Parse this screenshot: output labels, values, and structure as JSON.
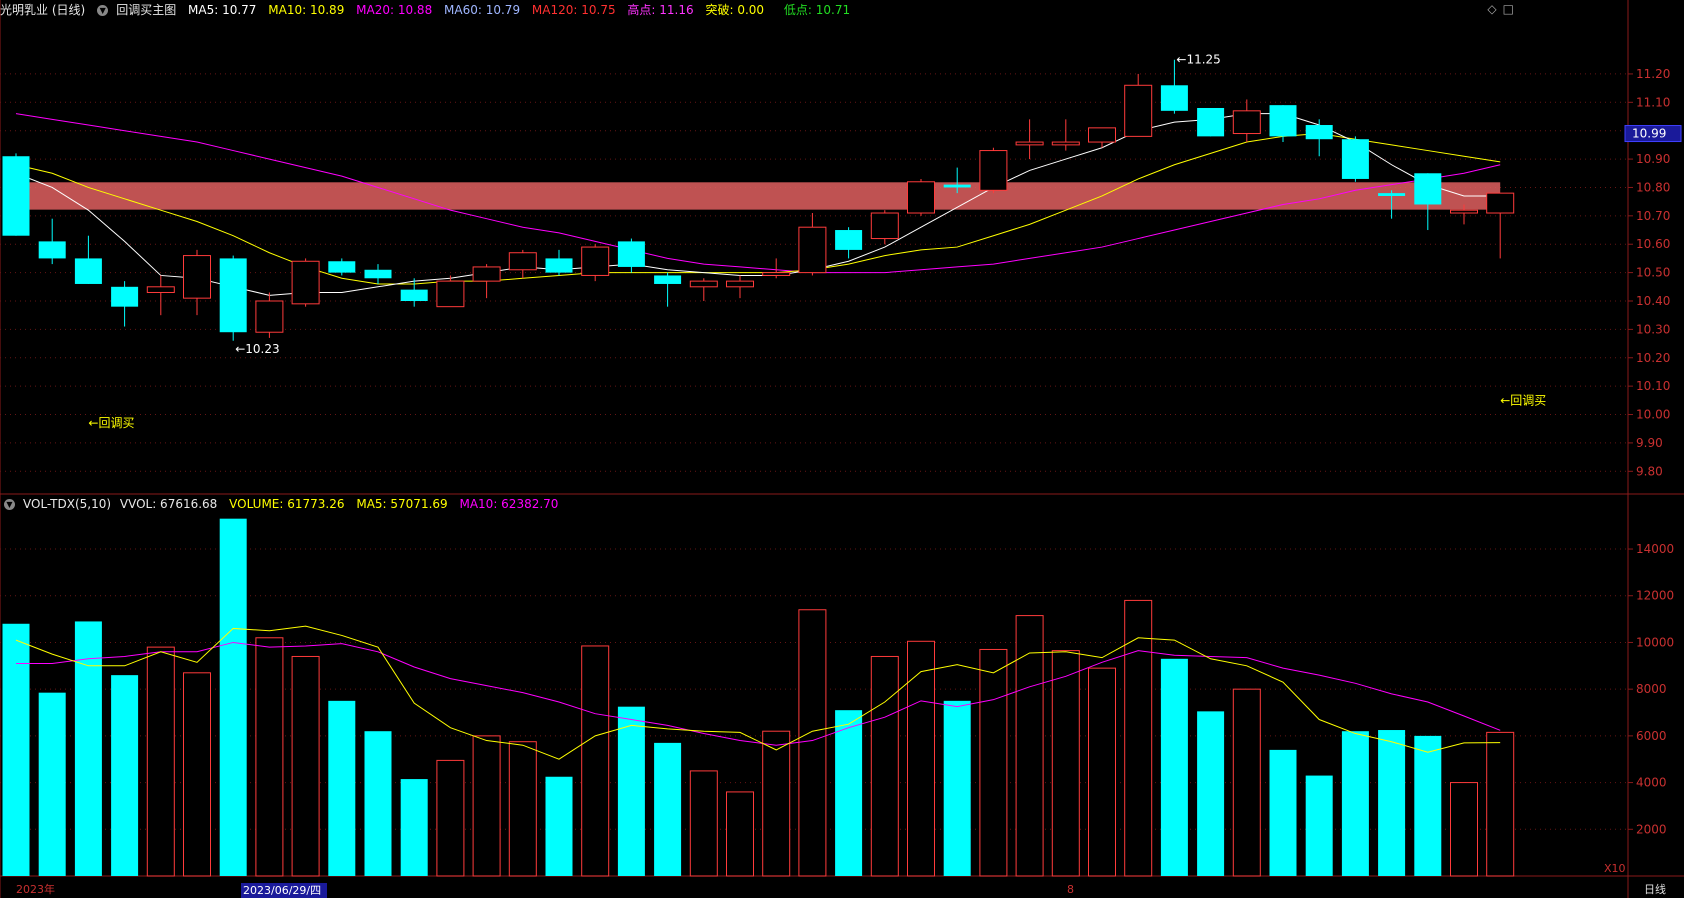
{
  "header": {
    "stock_title": "光明乳业 (日线)",
    "indicator_name": "回调买主图",
    "ma5": "MA5: 10.77",
    "ma10": "MA10: 10.89",
    "ma20": "MA20: 10.88",
    "ma60": "MA60: 10.79",
    "ma120": "MA120: 10.75",
    "high": "高点: 11.16",
    "breakout": "突破: 0.00",
    "low": "低点: 10.71"
  },
  "volume_header": {
    "name": "VOL-TDX(5,10)",
    "vvol": "VVOL: 67616.68",
    "volume": "VOLUME: 61773.26",
    "ma5": "MA5: 57071.69",
    "ma10": "MA10: 62382.70"
  },
  "colors": {
    "up": "#ff3b3b",
    "down": "#00ffff",
    "ma5": "#ffffff",
    "ma10": "#ffff00",
    "ma20": "#ff00ff",
    "band": "#e06060"
  },
  "icons": [
    "diamond-icon",
    "square-icon"
  ],
  "chart_data": [
    {
      "type": "candlestick",
      "y_ticks": [
        "11.20",
        "11.10",
        "11.00",
        "10.90",
        "10.80",
        "10.70",
        "10.60",
        "10.50",
        "10.40",
        "10.30",
        "10.20",
        "10.10",
        "10.00",
        "9.90",
        "9.80"
      ],
      "y_range": [
        9.72,
        11.39
      ],
      "current_price": "10.99",
      "candles": [
        {
          "o": 10.91,
          "h": 10.92,
          "l": 10.63,
          "c": 10.63
        },
        {
          "o": 10.61,
          "h": 10.69,
          "l": 10.53,
          "c": 10.55
        },
        {
          "o": 10.55,
          "h": 10.63,
          "l": 10.46,
          "c": 10.46
        },
        {
          "o": 10.45,
          "h": 10.47,
          "l": 10.31,
          "c": 10.38
        },
        {
          "o": 10.43,
          "h": 10.49,
          "l": 10.35,
          "c": 10.45
        },
        {
          "o": 10.41,
          "h": 10.58,
          "l": 10.35,
          "c": 10.56
        },
        {
          "o": 10.55,
          "h": 10.56,
          "l": 10.26,
          "c": 10.29
        },
        {
          "o": 10.29,
          "h": 10.43,
          "l": 10.27,
          "c": 10.4
        },
        {
          "o": 10.39,
          "h": 10.55,
          "l": 10.38,
          "c": 10.54
        },
        {
          "o": 10.54,
          "h": 10.55,
          "l": 10.49,
          "c": 10.5
        },
        {
          "o": 10.51,
          "h": 10.53,
          "l": 10.46,
          "c": 10.48
        },
        {
          "o": 10.44,
          "h": 10.48,
          "l": 10.38,
          "c": 10.4
        },
        {
          "o": 10.38,
          "h": 10.49,
          "l": 10.38,
          "c": 10.47
        },
        {
          "o": 10.47,
          "h": 10.53,
          "l": 10.41,
          "c": 10.52
        },
        {
          "o": 10.51,
          "h": 10.58,
          "l": 10.48,
          "c": 10.57
        },
        {
          "o": 10.55,
          "h": 10.58,
          "l": 10.49,
          "c": 10.5
        },
        {
          "o": 10.49,
          "h": 10.6,
          "l": 10.47,
          "c": 10.59
        },
        {
          "o": 10.61,
          "h": 10.62,
          "l": 10.5,
          "c": 10.52
        },
        {
          "o": 10.49,
          "h": 10.5,
          "l": 10.38,
          "c": 10.46
        },
        {
          "o": 10.45,
          "h": 10.48,
          "l": 10.4,
          "c": 10.47
        },
        {
          "o": 10.45,
          "h": 10.49,
          "l": 10.41,
          "c": 10.47
        },
        {
          "o": 10.49,
          "h": 10.55,
          "l": 10.48,
          "c": 10.5
        },
        {
          "o": 10.5,
          "h": 10.71,
          "l": 10.49,
          "c": 10.66
        },
        {
          "o": 10.65,
          "h": 10.66,
          "l": 10.55,
          "c": 10.58
        },
        {
          "o": 10.62,
          "h": 10.72,
          "l": 10.6,
          "c": 10.71
        },
        {
          "o": 10.71,
          "h": 10.83,
          "l": 10.7,
          "c": 10.82
        },
        {
          "o": 10.81,
          "h": 10.87,
          "l": 10.78,
          "c": 10.8
        },
        {
          "o": 10.79,
          "h": 10.94,
          "l": 10.78,
          "c": 10.93
        },
        {
          "o": 10.95,
          "h": 11.04,
          "l": 10.9,
          "c": 10.96
        },
        {
          "o": 10.95,
          "h": 11.04,
          "l": 10.93,
          "c": 10.96
        },
        {
          "o": 10.96,
          "h": 11.01,
          "l": 10.94,
          "c": 11.01
        },
        {
          "o": 10.98,
          "h": 11.2,
          "l": 10.98,
          "c": 11.16
        },
        {
          "o": 11.16,
          "h": 11.25,
          "l": 11.06,
          "c": 11.07
        },
        {
          "o": 11.08,
          "h": 11.08,
          "l": 10.98,
          "c": 10.98
        },
        {
          "o": 10.99,
          "h": 11.11,
          "l": 10.96,
          "c": 11.07
        },
        {
          "o": 11.09,
          "h": 11.09,
          "l": 10.96,
          "c": 10.98
        },
        {
          "o": 11.02,
          "h": 11.04,
          "l": 10.91,
          "c": 10.97
        },
        {
          "o": 10.97,
          "h": 10.98,
          "l": 10.82,
          "c": 10.83
        },
        {
          "o": 10.78,
          "h": 10.79,
          "l": 10.69,
          "c": 10.77
        },
        {
          "o": 10.85,
          "h": 10.85,
          "l": 10.65,
          "c": 10.74
        },
        {
          "o": 10.71,
          "h": 10.74,
          "l": 10.67,
          "c": 10.72
        },
        {
          "o": 10.71,
          "h": 10.78,
          "l": 10.55,
          "c": 10.78
        }
      ],
      "ma5": [
        10.85,
        10.8,
        10.72,
        10.61,
        10.49,
        10.48,
        10.45,
        10.42,
        10.43,
        10.43,
        10.45,
        10.47,
        10.48,
        10.5,
        10.52,
        10.51,
        10.52,
        10.53,
        10.51,
        10.5,
        10.49,
        10.49,
        10.51,
        10.54,
        10.59,
        10.66,
        10.73,
        10.8,
        10.86,
        10.9,
        10.94,
        11.0,
        11.03,
        11.04,
        11.06,
        11.06,
        11.02,
        10.96,
        10.88,
        10.81,
        10.77,
        10.77
      ],
      "ma10": [
        10.88,
        10.85,
        10.8,
        10.76,
        10.72,
        10.68,
        10.63,
        10.57,
        10.52,
        10.48,
        10.46,
        10.46,
        10.47,
        10.47,
        10.48,
        10.49,
        10.5,
        10.5,
        10.5,
        10.5,
        10.5,
        10.5,
        10.51,
        10.53,
        10.56,
        10.58,
        10.59,
        10.63,
        10.67,
        10.72,
        10.77,
        10.83,
        10.88,
        10.92,
        10.96,
        10.98,
        10.99,
        10.97,
        10.95,
        10.93,
        10.91,
        10.89
      ],
      "ma20": [
        11.06,
        11.04,
        11.02,
        11.0,
        10.98,
        10.96,
        10.93,
        10.9,
        10.87,
        10.84,
        10.8,
        10.76,
        10.72,
        10.69,
        10.66,
        10.64,
        10.61,
        10.58,
        10.55,
        10.53,
        10.52,
        10.51,
        10.5,
        10.5,
        10.5,
        10.51,
        10.52,
        10.53,
        10.55,
        10.57,
        10.59,
        10.62,
        10.65,
        10.68,
        10.71,
        10.74,
        10.76,
        10.79,
        10.81,
        10.83,
        10.85,
        10.88
      ],
      "ma60": 10.79,
      "ma120": 10.75,
      "annotations": [
        {
          "text": "10.23",
          "value": 10.23,
          "bar": 6
        },
        {
          "text": "11.25",
          "value": 11.25,
          "bar": 32
        },
        {
          "text": "←回调买",
          "value": 9.97,
          "bar": 2
        },
        {
          "text": "←回调买",
          "value": 10.05,
          "bar": 41
        }
      ],
      "x_labels": [
        "2023年",
        "2023/06/29/四",
        "8"
      ],
      "period_label": "日线"
    },
    {
      "type": "bar",
      "y_ticks": [
        "14000",
        "12000",
        "10000",
        "8000",
        "6000",
        "4000",
        "2000"
      ],
      "y_range": [
        0,
        15500
      ],
      "scale_label": "X10",
      "volumes": [
        10800,
        7850,
        10900,
        8600,
        9800,
        8700,
        15300,
        10200,
        9400,
        7500,
        6200,
        4150,
        4950,
        6000,
        5750,
        4250,
        9850,
        7250,
        5700,
        4500,
        3600,
        6200,
        11400,
        7100,
        9400,
        10050,
        7500,
        9700,
        11150,
        9650,
        8900,
        11800,
        9300,
        7050,
        8000,
        5400,
        4300,
        6200,
        6250,
        6000,
        4000,
        6150
      ],
      "vol_ma5": [
        10100,
        9500,
        9000,
        9000,
        9600,
        9150,
        10600,
        10500,
        10700,
        10300,
        9800,
        7400,
        6350,
        5800,
        5600,
        5000,
        6000,
        6450,
        6300,
        6200,
        6150,
        5400,
        6200,
        6500,
        7450,
        8750,
        9050,
        8700,
        9550,
        9600,
        9350,
        10200,
        10100,
        9300,
        9000,
        8300,
        6700,
        6100,
        5750,
        5300,
        5700,
        5710
      ],
      "vol_ma10": [
        9100,
        9100,
        9300,
        9400,
        9600,
        9600,
        10000,
        9800,
        9850,
        9950,
        9600,
        8950,
        8450,
        8150,
        7850,
        7450,
        6950,
        6700,
        6450,
        6100,
        5800,
        5600,
        5800,
        6350,
        6800,
        7500,
        7250,
        7550,
        8100,
        8550,
        9150,
        9650,
        9450,
        9400,
        9350,
        8900,
        8600,
        8250,
        7800,
        7450,
        6850,
        6238
      ]
    }
  ]
}
